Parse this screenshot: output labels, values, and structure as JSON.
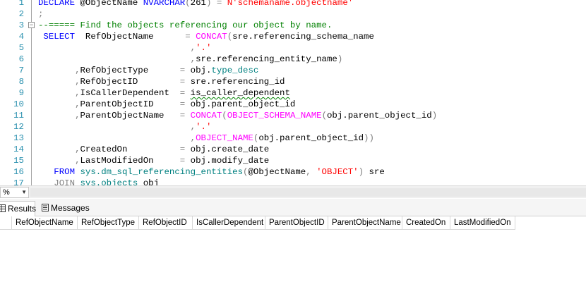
{
  "editor": {
    "line_numbers": [
      "1",
      "2",
      "3",
      "4",
      "5",
      "6",
      "7",
      "8",
      "9",
      "10",
      "11",
      "12",
      "13",
      "14",
      "15",
      "16",
      "17"
    ],
    "lines": {
      "l1": {
        "kw1": "DECLARE",
        "var": " @ObjectName ",
        "type": "NVARCHAR",
        "gry1": "(",
        "num": "261",
        "gry2": ") = ",
        "str": "N'schemaname.objectname'"
      },
      "l2": {
        "text": ";"
      },
      "l3": {
        "text": "--===== Find the objects referencing our object by name."
      },
      "l4": {
        "kw": " SELECT",
        "col": "  RefObjectName      ",
        "eq": "= ",
        "fn": "CONCAT",
        "p": "(",
        "rest": "sre.referencing_schema_name"
      },
      "l5": {
        "pad": "                             ",
        "comma": ",",
        "str": "'.'"
      },
      "l6": {
        "pad": "                             ",
        "comma": ",",
        "rest": "sre.referencing_entity_name",
        "close": ")"
      },
      "l7": {
        "pad": "       ",
        "comma": ",",
        "col": "RefObjectType      ",
        "eq": "= ",
        "rest": "obj.",
        "sys": "type_desc"
      },
      "l8": {
        "pad": "       ",
        "comma": ",",
        "col": "RefObjectID        ",
        "eq": "= ",
        "rest": "sre.referencing_id"
      },
      "l9": {
        "pad": "       ",
        "comma": ",",
        "col": "IsCallerDependent  ",
        "eq": "= ",
        "rest": "is_caller_dependent"
      },
      "l10": {
        "pad": "       ",
        "comma": ",",
        "col": "ParentObjectID     ",
        "eq": "= ",
        "rest": "obj.parent_object_id"
      },
      "l11": {
        "pad": "       ",
        "comma": ",",
        "col": "ParentObjectName   ",
        "eq": "= ",
        "fn": "CONCAT",
        "p": "(",
        "fn2": "OBJECT_SCHEMA_NAME",
        "p2": "(",
        "rest": "obj.parent_object_id",
        "close": ")"
      },
      "l12": {
        "pad": "                             ",
        "comma": ",",
        "str": "'.'"
      },
      "l13": {
        "pad": "                             ",
        "comma": ",",
        "fn": "OBJECT_NAME",
        "p": "(",
        "rest": "obj.parent_object_id",
        "close": "))"
      },
      "l14": {
        "pad": "       ",
        "comma": ",",
        "col": "CreatedOn          ",
        "eq": "= ",
        "rest": "obj.create_date"
      },
      "l15": {
        "pad": "       ",
        "comma": ",",
        "col": "LastModifiedOn     ",
        "eq": "= ",
        "rest": "obj.modify_date"
      },
      "l16": {
        "kw": "   FROM ",
        "sys": "sys.dm_sql_referencing_entities",
        "p": "(",
        "var": "@ObjectName",
        "comma": ", ",
        "str": "'OBJECT'",
        "close": ")",
        "alias": " sre"
      },
      "l17": {
        "kw": "   JOIN ",
        "sys": "sys.objects",
        "alias": " obj"
      }
    }
  },
  "zoom": {
    "value": "%"
  },
  "tabs": {
    "results": "Results",
    "messages": "Messages"
  },
  "grid": {
    "columns": [
      "RefObjectName",
      "RefObjectType",
      "RefObjectID",
      "IsCallerDependent",
      "ParentObjectID",
      "ParentObjectName",
      "CreatedOn",
      "LastModifiedOn"
    ]
  },
  "colors": {
    "keyword": "#0000ff",
    "function": "#ff00ff",
    "string": "#ff0000",
    "comment": "#008000",
    "system": "#008080",
    "line_number": "#2b91af"
  }
}
